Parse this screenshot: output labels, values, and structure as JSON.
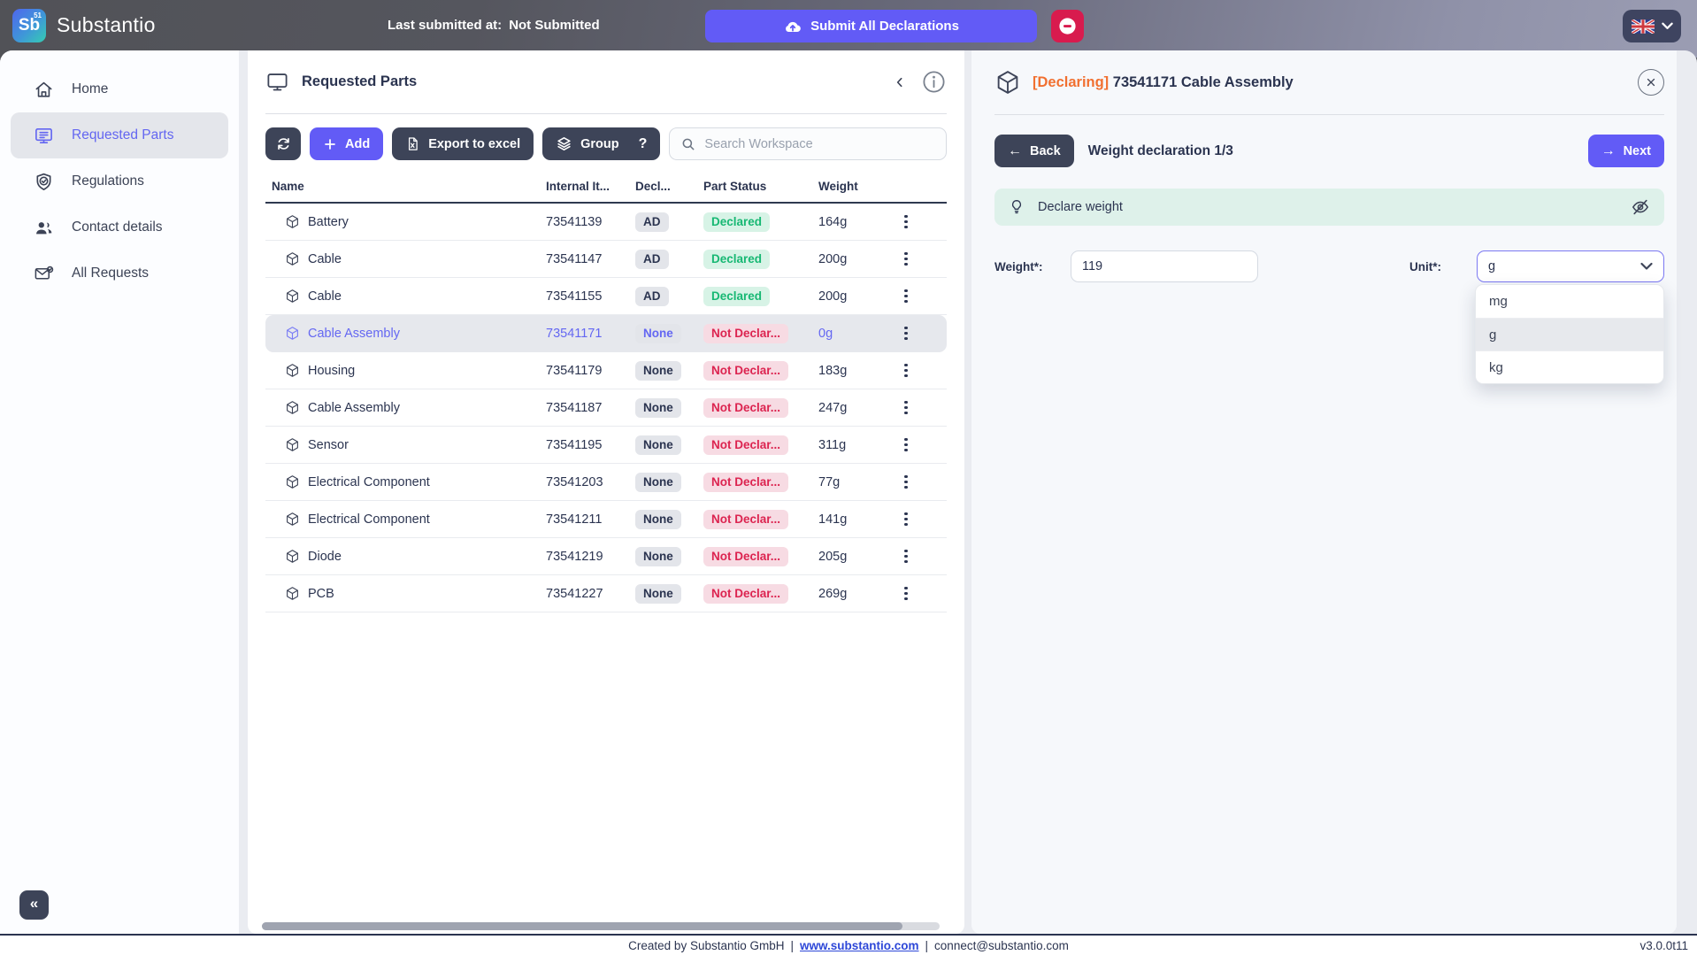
{
  "topbar": {
    "logo_abbr": "Sb",
    "logo_superscript": "51",
    "brand": "Substantio",
    "last_submitted_label": "Last submitted at:",
    "last_submitted_value": "Not Submitted",
    "submit_label": "Submit All Declarations"
  },
  "sidebar": {
    "items": [
      {
        "label": "Home",
        "active": false
      },
      {
        "label": "Requested Parts",
        "active": true
      },
      {
        "label": "Regulations",
        "active": false
      },
      {
        "label": "Contact details",
        "active": false
      },
      {
        "label": "All Requests",
        "active": false
      }
    ]
  },
  "parts_panel": {
    "title": "Requested Parts",
    "toolbar": {
      "add_label": "Add",
      "export_label": "Export to excel",
      "group_label": "Group",
      "help_glyph": "?",
      "search_placeholder": "Search Workspace"
    },
    "table": {
      "columns": [
        "Name",
        "Internal It...",
        "Decl...",
        "Part Status",
        "Weight"
      ],
      "rows": [
        {
          "name": "Battery",
          "internal": "73541139",
          "decl": "AD",
          "status": "Declared",
          "status_ok": true,
          "weight": "164g",
          "selected": false
        },
        {
          "name": "Cable",
          "internal": "73541147",
          "decl": "AD",
          "status": "Declared",
          "status_ok": true,
          "weight": "200g",
          "selected": false
        },
        {
          "name": "Cable",
          "internal": "73541155",
          "decl": "AD",
          "status": "Declared",
          "status_ok": true,
          "weight": "200g",
          "selected": false
        },
        {
          "name": "Cable Assembly",
          "internal": "73541171",
          "decl": "None",
          "status": "Not Declar...",
          "status_ok": false,
          "weight": "0g",
          "selected": true
        },
        {
          "name": "Housing",
          "internal": "73541179",
          "decl": "None",
          "status": "Not Declar...",
          "status_ok": false,
          "weight": "183g",
          "selected": false
        },
        {
          "name": "Cable Assembly",
          "internal": "73541187",
          "decl": "None",
          "status": "Not Declar...",
          "status_ok": false,
          "weight": "247g",
          "selected": false
        },
        {
          "name": "Sensor",
          "internal": "73541195",
          "decl": "None",
          "status": "Not Declar...",
          "status_ok": false,
          "weight": "311g",
          "selected": false
        },
        {
          "name": "Electrical Component",
          "internal": "73541203",
          "decl": "None",
          "status": "Not Declar...",
          "status_ok": false,
          "weight": "77g",
          "selected": false
        },
        {
          "name": "Electrical Component",
          "internal": "73541211",
          "decl": "None",
          "status": "Not Declar...",
          "status_ok": false,
          "weight": "141g",
          "selected": false
        },
        {
          "name": "Diode",
          "internal": "73541219",
          "decl": "None",
          "status": "Not Declar...",
          "status_ok": false,
          "weight": "205g",
          "selected": false
        },
        {
          "name": "PCB",
          "internal": "73541227",
          "decl": "None",
          "status": "Not Declar...",
          "status_ok": false,
          "weight": "269g",
          "selected": false
        }
      ]
    }
  },
  "declaration_panel": {
    "declaring_tag": "[Declaring]",
    "part_title": "73541171 Cable Assembly",
    "back_label": "Back",
    "step_title": "Weight declaration 1/3",
    "next_label": "Next",
    "hint_text": "Declare weight",
    "weight_label": "Weight*:",
    "weight_value": "119",
    "unit_label": "Unit*:",
    "unit_value": "g",
    "unit_options": [
      "mg",
      "g",
      "kg"
    ]
  },
  "icons_glyphs": {
    "back_arrow": "←",
    "next_arrow": "→",
    "collapse": "«"
  },
  "footer": {
    "created": "Created by Substantio GmbH",
    "separator": "|",
    "link": "www.substantio.com",
    "email": "connect@substantio.com",
    "version": "v3.0.0t11"
  },
  "colors": {
    "accent_indigo": "#625bf6",
    "accent_purple": "#6467f2",
    "danger_red": "#d81b4e",
    "declared_green": "#17b873",
    "not_declared_red": "#dc2450",
    "declaring_orange": "#f17030",
    "dark_button": "#3d4458",
    "hint_mint": "#def1ea"
  }
}
